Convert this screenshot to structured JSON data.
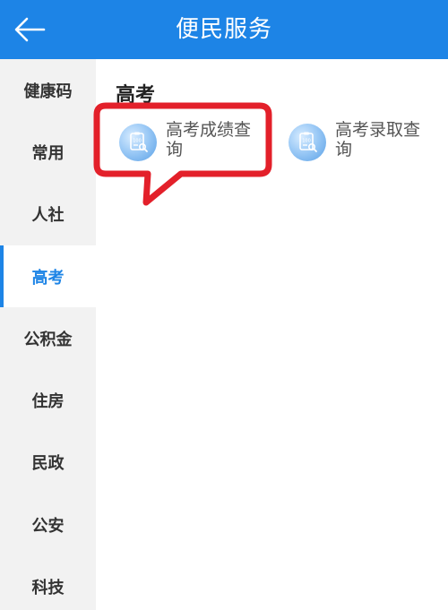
{
  "header": {
    "title": "便民服务",
    "back_icon": "arrow-left-icon",
    "background": "#1d84e6"
  },
  "sidebar": {
    "items": [
      {
        "label": "健康码",
        "active": false
      },
      {
        "label": "常用",
        "active": false
      },
      {
        "label": "人社",
        "active": false
      },
      {
        "label": "高考",
        "active": true
      },
      {
        "label": "公积金",
        "active": false
      },
      {
        "label": "住房",
        "active": false
      },
      {
        "label": "民政",
        "active": false
      },
      {
        "label": "公安",
        "active": false
      },
      {
        "label": "科技",
        "active": false
      }
    ],
    "active_color": "#1d84e6"
  },
  "main": {
    "section_title": "高考",
    "services": [
      {
        "label": "高考成绩查询",
        "icon": "exam-score-icon"
      },
      {
        "label": "高考录取查询",
        "icon": "exam-admission-icon"
      }
    ]
  },
  "annotation": {
    "color": "#e3202a"
  }
}
